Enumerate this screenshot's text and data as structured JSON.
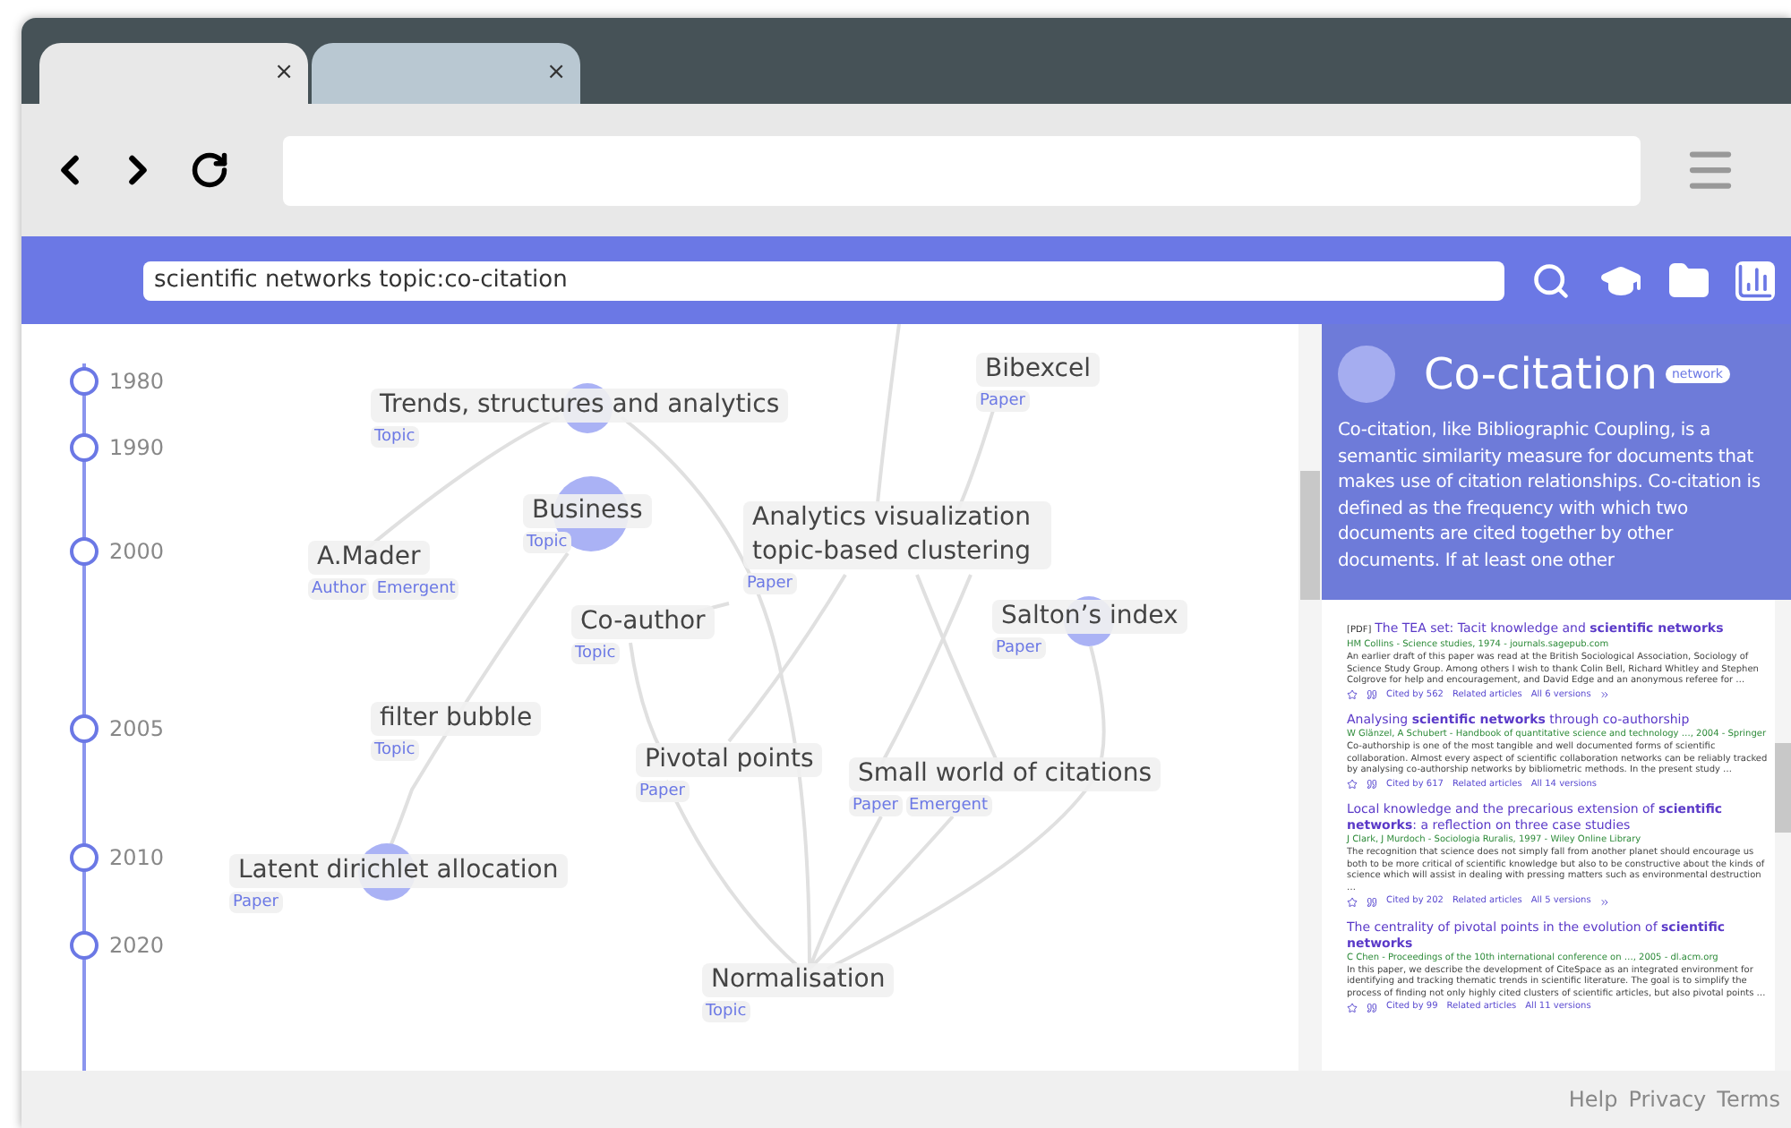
{
  "tabs": [
    {
      "selected": true,
      "close": "×"
    },
    {
      "selected": false,
      "close": "×"
    }
  ],
  "search": {
    "value": "scientific networks topic:co-citation"
  },
  "timeline": [
    "1980",
    "1990",
    "2000",
    "2005",
    "2010",
    "2020"
  ],
  "nodes": [
    {
      "label": "Trends, structures and analytics",
      "tags": [
        "Topic"
      ]
    },
    {
      "label": "Bibexcel",
      "tags": [
        "Paper"
      ]
    },
    {
      "label": "Business",
      "tags": [
        "Topic"
      ]
    },
    {
      "label": "A.Mader",
      "tags": [
        "Author",
        "Emergent"
      ]
    },
    {
      "label": "Analytics visualization topic-based clustering",
      "tags": [
        "Paper"
      ]
    },
    {
      "label": "Co-author",
      "tags": [
        "Topic"
      ]
    },
    {
      "label": "Salton’s index",
      "tags": [
        "Paper"
      ]
    },
    {
      "label": "filter bubble",
      "tags": [
        "Topic"
      ]
    },
    {
      "label": "Pivotal points",
      "tags": [
        "Paper"
      ]
    },
    {
      "label": "Small world of citations",
      "tags": [
        "Paper",
        "Emergent"
      ]
    },
    {
      "label": "Latent dirichlet allocation",
      "tags": [
        "Paper"
      ]
    },
    {
      "label": "Normalisation",
      "tags": [
        "Topic"
      ]
    }
  ],
  "detail": {
    "title": "Co-citation",
    "badge": "network",
    "text": "Co-citation, like Bibliographic Coupling, is a semantic similarity measure for documents that makes use of citation relationships. Co-citation is defined as the frequency with which two documents are cited together by other documents. If at least one other"
  },
  "results": [
    {
      "prefix": "[PDF]",
      "title": "The TEA set: Tacit knowledge and **scientific networks**",
      "source": "HM Collins - Science studies, 1974 - journals.sagepub.com",
      "snippet": "An earlier draft of this paper was read at the British Sociological Association, Sociology of Science Study Group. Among others I wish to thank Colin Bell, Richard Whitley and Stephen Colgrove for help and encouragement, and David Edge and an anonymous referee for …",
      "actions": [
        "Cited by 562",
        "Related articles",
        "All 6 versions"
      ],
      "more": true
    },
    {
      "title": "Analysing **scientific networks** through co-authorship",
      "source": "W Glänzel, A Schubert - Handbook of quantitative science and technology …, 2004 - Springer",
      "snippet": "Co-authorship is one of the most tangible and well documented forms of scientific collaboration. Almost every aspect of scientific collaboration networks can be reliably tracked by analysing co-authorship networks by bibliometric methods. In the present study …",
      "actions": [
        "Cited by 617",
        "Related articles",
        "All 14 versions"
      ],
      "more": false
    },
    {
      "title": "Local knowledge and the precarious extension of **scientific networks**: a reflection on three case studies",
      "source": "J Clark, J Murdoch - Sociologia Ruralis, 1997 - Wiley Online Library",
      "snippet": "The recognition that science does not simply fall from another planet should encourage us both to be more critical of scientific knowledge but also to be constructive about the kinds of science which will assist in dealing with pressing matters such as environmental destruction …",
      "actions": [
        "Cited by 202",
        "Related articles",
        "All 5 versions"
      ],
      "more": true
    },
    {
      "title": "The centrality of pivotal points in the evolution of **scientific networks**",
      "source": "C Chen - Proceedings of the 10th international conference on …, 2005 - dl.acm.org",
      "snippet": "In this paper, we describe the development of CiteSpace as an integrated environment for identifying and tracking thematic trends in scientific literature. The goal is to simplify the process of finding not only highly cited clusters of scientific articles, but also pivotal points …",
      "actions": [
        "Cited by 99",
        "Related articles",
        "All 11 versions"
      ],
      "more": false
    }
  ],
  "footer": [
    "Help",
    "Privacy",
    "Terms"
  ]
}
